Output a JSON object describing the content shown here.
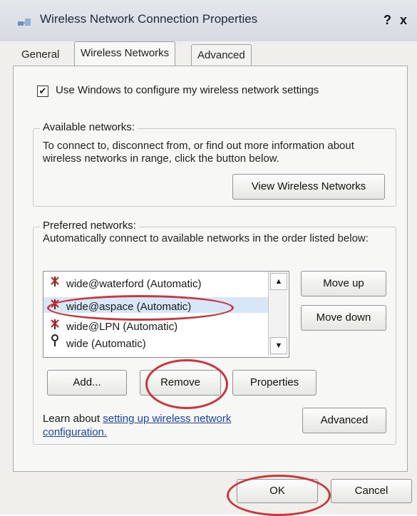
{
  "window": {
    "title": "Wireless Network Connection Properties",
    "help_label": "?",
    "close_label": "x"
  },
  "tabs": [
    {
      "label": "General"
    },
    {
      "label": "Wireless Networks"
    },
    {
      "label": "Advanced"
    }
  ],
  "wireless_config": {
    "checked": true,
    "check_mark": "✔",
    "label": "Use Windows to configure my wireless network settings"
  },
  "available": {
    "label": "Available networks:",
    "description": "To connect to, disconnect from, or find out more information about wireless networks in range, click the button below.",
    "view_button": "View Wireless Networks"
  },
  "preferred": {
    "label": "Preferred networks:",
    "description": "Automatically connect to available networks in the order listed below:",
    "items": [
      {
        "name": "wide@waterford (Automatic)",
        "icon": "wireless-x-icon"
      },
      {
        "name": "wide@aspace (Automatic)",
        "icon": "wireless-x-icon"
      },
      {
        "name": "wide@LPN (Automatic)",
        "icon": "wireless-x-icon"
      },
      {
        "name": "wide (Automatic)",
        "icon": "wireless-antenna-icon"
      }
    ],
    "selected_index": 1,
    "move_up": "Move up",
    "move_down": "Move down",
    "add": "Add...",
    "remove": "Remove",
    "properties": "Properties"
  },
  "learn": {
    "prefix": "Learn about ",
    "link": "setting up wireless network configuration.",
    "advanced_button": "Advanced"
  },
  "footer": {
    "ok": "OK",
    "cancel": "Cancel"
  },
  "colors": {
    "annotation": "#c9363c",
    "selection": "#d7e7f7",
    "link": "#1a44b8"
  }
}
